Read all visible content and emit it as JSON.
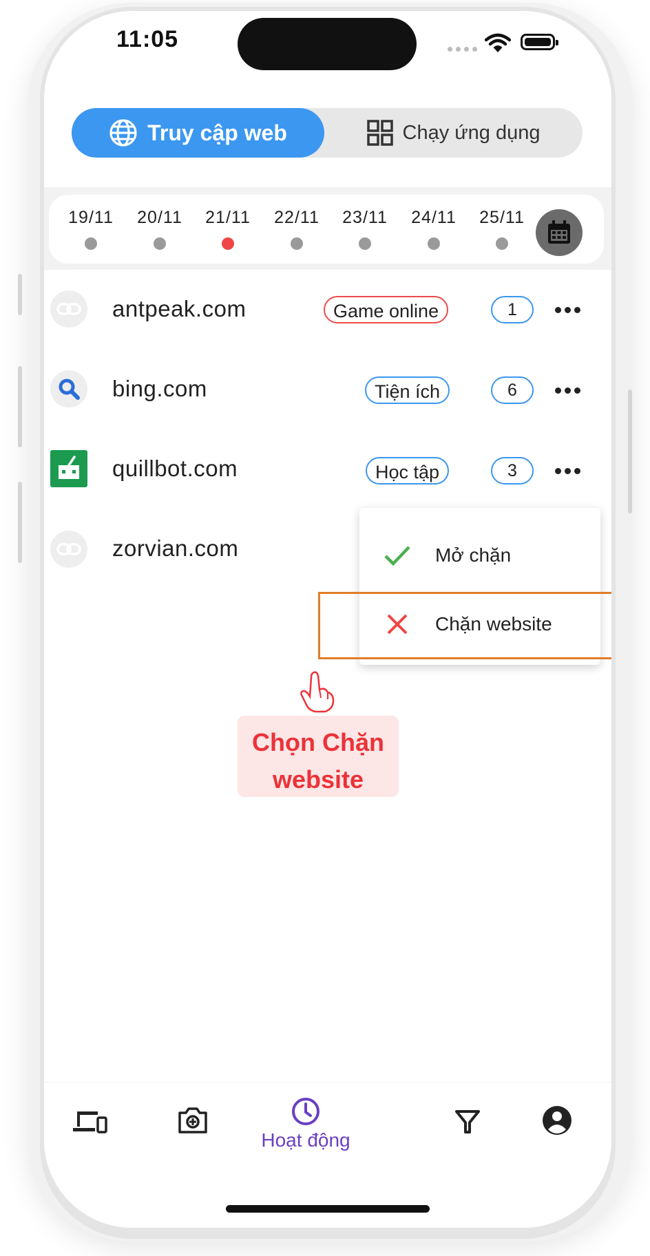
{
  "status_bar": {
    "time": "11:05"
  },
  "tabs": {
    "web": "Truy cập web",
    "apps": "Chạy ứng dụng"
  },
  "dates": [
    "19/11",
    "20/11",
    "21/11",
    "22/11",
    "23/11",
    "24/11",
    "25/11"
  ],
  "selected_date": "21/11",
  "sites": [
    {
      "domain": "antpeak.com",
      "category": "Game online",
      "count": "1",
      "icon": "link-icon"
    },
    {
      "domain": "bing.com",
      "category": "Tiện ích",
      "count": "6",
      "icon": "search-icon"
    },
    {
      "domain": "quillbot.com",
      "category": "Học tập",
      "count": "3",
      "icon": "quillbot-logo-icon"
    },
    {
      "domain": "zorvian.com",
      "icon": "link-icon"
    }
  ],
  "menu": {
    "unblock": "Mở chặn",
    "block": "Chặn website"
  },
  "annotation": {
    "line1": "Chọn Chặn",
    "line2": "website"
  },
  "bottom_nav": {
    "activity_label": "Hoạt động"
  },
  "colors": {
    "accent": "#3b97f0",
    "danger": "#ec3238",
    "nav_active": "#6a3fc2",
    "highlight": "#e07d2a"
  }
}
